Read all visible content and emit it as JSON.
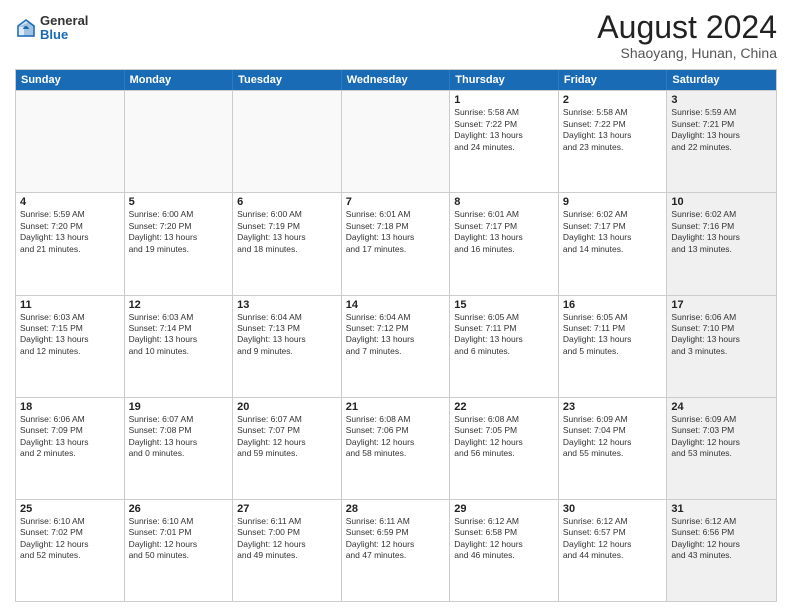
{
  "logo": {
    "general": "General",
    "blue": "Blue"
  },
  "title": "August 2024",
  "location": "Shaoyang, Hunan, China",
  "days": [
    "Sunday",
    "Monday",
    "Tuesday",
    "Wednesday",
    "Thursday",
    "Friday",
    "Saturday"
  ],
  "weeks": [
    [
      {
        "day": "",
        "text": "",
        "empty": true
      },
      {
        "day": "",
        "text": "",
        "empty": true
      },
      {
        "day": "",
        "text": "",
        "empty": true
      },
      {
        "day": "",
        "text": "",
        "empty": true
      },
      {
        "day": "1",
        "text": "Sunrise: 5:58 AM\nSunset: 7:22 PM\nDaylight: 13 hours\nand 24 minutes.",
        "empty": false
      },
      {
        "day": "2",
        "text": "Sunrise: 5:58 AM\nSunset: 7:22 PM\nDaylight: 13 hours\nand 23 minutes.",
        "empty": false
      },
      {
        "day": "3",
        "text": "Sunrise: 5:59 AM\nSunset: 7:21 PM\nDaylight: 13 hours\nand 22 minutes.",
        "empty": false,
        "shaded": true
      }
    ],
    [
      {
        "day": "4",
        "text": "Sunrise: 5:59 AM\nSunset: 7:20 PM\nDaylight: 13 hours\nand 21 minutes.",
        "empty": false
      },
      {
        "day": "5",
        "text": "Sunrise: 6:00 AM\nSunset: 7:20 PM\nDaylight: 13 hours\nand 19 minutes.",
        "empty": false
      },
      {
        "day": "6",
        "text": "Sunrise: 6:00 AM\nSunset: 7:19 PM\nDaylight: 13 hours\nand 18 minutes.",
        "empty": false
      },
      {
        "day": "7",
        "text": "Sunrise: 6:01 AM\nSunset: 7:18 PM\nDaylight: 13 hours\nand 17 minutes.",
        "empty": false
      },
      {
        "day": "8",
        "text": "Sunrise: 6:01 AM\nSunset: 7:17 PM\nDaylight: 13 hours\nand 16 minutes.",
        "empty": false
      },
      {
        "day": "9",
        "text": "Sunrise: 6:02 AM\nSunset: 7:17 PM\nDaylight: 13 hours\nand 14 minutes.",
        "empty": false
      },
      {
        "day": "10",
        "text": "Sunrise: 6:02 AM\nSunset: 7:16 PM\nDaylight: 13 hours\nand 13 minutes.",
        "empty": false,
        "shaded": true
      }
    ],
    [
      {
        "day": "11",
        "text": "Sunrise: 6:03 AM\nSunset: 7:15 PM\nDaylight: 13 hours\nand 12 minutes.",
        "empty": false
      },
      {
        "day": "12",
        "text": "Sunrise: 6:03 AM\nSunset: 7:14 PM\nDaylight: 13 hours\nand 10 minutes.",
        "empty": false
      },
      {
        "day": "13",
        "text": "Sunrise: 6:04 AM\nSunset: 7:13 PM\nDaylight: 13 hours\nand 9 minutes.",
        "empty": false
      },
      {
        "day": "14",
        "text": "Sunrise: 6:04 AM\nSunset: 7:12 PM\nDaylight: 13 hours\nand 7 minutes.",
        "empty": false
      },
      {
        "day": "15",
        "text": "Sunrise: 6:05 AM\nSunset: 7:11 PM\nDaylight: 13 hours\nand 6 minutes.",
        "empty": false
      },
      {
        "day": "16",
        "text": "Sunrise: 6:05 AM\nSunset: 7:11 PM\nDaylight: 13 hours\nand 5 minutes.",
        "empty": false
      },
      {
        "day": "17",
        "text": "Sunrise: 6:06 AM\nSunset: 7:10 PM\nDaylight: 13 hours\nand 3 minutes.",
        "empty": false,
        "shaded": true
      }
    ],
    [
      {
        "day": "18",
        "text": "Sunrise: 6:06 AM\nSunset: 7:09 PM\nDaylight: 13 hours\nand 2 minutes.",
        "empty": false
      },
      {
        "day": "19",
        "text": "Sunrise: 6:07 AM\nSunset: 7:08 PM\nDaylight: 13 hours\nand 0 minutes.",
        "empty": false
      },
      {
        "day": "20",
        "text": "Sunrise: 6:07 AM\nSunset: 7:07 PM\nDaylight: 12 hours\nand 59 minutes.",
        "empty": false
      },
      {
        "day": "21",
        "text": "Sunrise: 6:08 AM\nSunset: 7:06 PM\nDaylight: 12 hours\nand 58 minutes.",
        "empty": false
      },
      {
        "day": "22",
        "text": "Sunrise: 6:08 AM\nSunset: 7:05 PM\nDaylight: 12 hours\nand 56 minutes.",
        "empty": false
      },
      {
        "day": "23",
        "text": "Sunrise: 6:09 AM\nSunset: 7:04 PM\nDaylight: 12 hours\nand 55 minutes.",
        "empty": false
      },
      {
        "day": "24",
        "text": "Sunrise: 6:09 AM\nSunset: 7:03 PM\nDaylight: 12 hours\nand 53 minutes.",
        "empty": false,
        "shaded": true
      }
    ],
    [
      {
        "day": "25",
        "text": "Sunrise: 6:10 AM\nSunset: 7:02 PM\nDaylight: 12 hours\nand 52 minutes.",
        "empty": false
      },
      {
        "day": "26",
        "text": "Sunrise: 6:10 AM\nSunset: 7:01 PM\nDaylight: 12 hours\nand 50 minutes.",
        "empty": false
      },
      {
        "day": "27",
        "text": "Sunrise: 6:11 AM\nSunset: 7:00 PM\nDaylight: 12 hours\nand 49 minutes.",
        "empty": false
      },
      {
        "day": "28",
        "text": "Sunrise: 6:11 AM\nSunset: 6:59 PM\nDaylight: 12 hours\nand 47 minutes.",
        "empty": false
      },
      {
        "day": "29",
        "text": "Sunrise: 6:12 AM\nSunset: 6:58 PM\nDaylight: 12 hours\nand 46 minutes.",
        "empty": false
      },
      {
        "day": "30",
        "text": "Sunrise: 6:12 AM\nSunset: 6:57 PM\nDaylight: 12 hours\nand 44 minutes.",
        "empty": false
      },
      {
        "day": "31",
        "text": "Sunrise: 6:12 AM\nSunset: 6:56 PM\nDaylight: 12 hours\nand 43 minutes.",
        "empty": false,
        "shaded": true
      }
    ]
  ]
}
